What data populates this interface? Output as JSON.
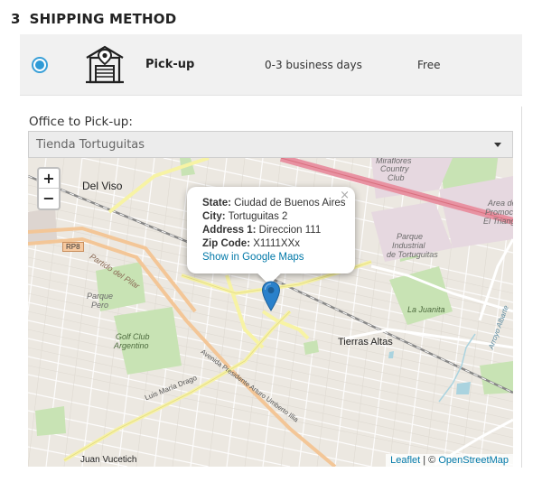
{
  "section": {
    "number": "3",
    "title": "SHIPPING METHOD"
  },
  "shipping_method": {
    "selected": true,
    "icon": "store-icon",
    "name": "Pick-up",
    "delivery_time": "0-3 business days",
    "price": "Free"
  },
  "office": {
    "label": "Office to Pick-up:",
    "selected": "Tienda Tortuguitas"
  },
  "map": {
    "zoom_in": "+",
    "zoom_out": "−",
    "popup": {
      "close": "×",
      "state_label": "State:",
      "state_value": "Ciudad de Buenos Aires",
      "city_label": "City:",
      "city_value": "Tortuguitas 2",
      "address_label": "Address 1:",
      "address_value": "Direccion 111",
      "zip_label": "Zip Code:",
      "zip_value": "X1111XXx",
      "link": "Show in Google Maps"
    },
    "attribution": {
      "leaflet": "Leaflet",
      "separator": " | © ",
      "osm": "OpenStreetMap"
    },
    "labels": {
      "del_viso": "Del Viso",
      "miraflores": "Miraflores",
      "country": "Country",
      "club": "Club",
      "area_de": "Area de",
      "promocion": "Promocion",
      "el_triangulo": "El Triang",
      "parque": "Parque",
      "industrial": "Industrial",
      "de_tortuguitas": "de Tortuguitas",
      "rp8": "RP8",
      "partido_del_pilar": "Partido del Pilar",
      "parque_pero_1": "Parque",
      "parque_pero_2": "Pero",
      "la_juanita": "La Juanita",
      "golf_club_1": "Golf Club",
      "golf_club_2": "Argentino",
      "tierras_altas": "Tierras Altas",
      "luis_maria_drago": "Luis María Drago",
      "av_presidente": "Avenida Presidente Arturo Umberto Illia",
      "juan_vucetich": "Juan Vucetich",
      "arroyo_albarte": "Arroyo Albarte"
    }
  }
}
